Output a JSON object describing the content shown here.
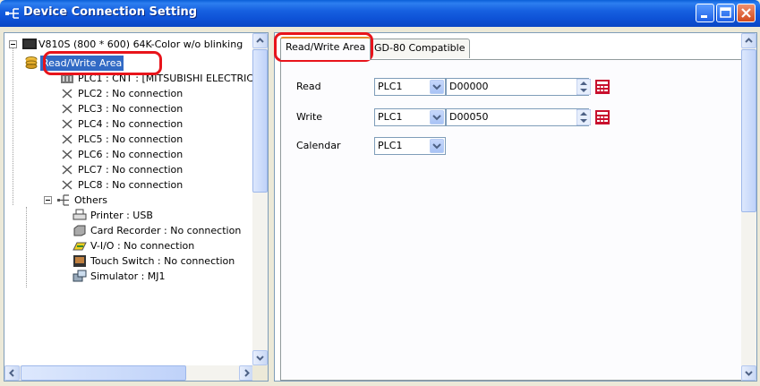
{
  "window": {
    "title": "Device Connection Setting"
  },
  "tree": {
    "root_label": "V810S (800 * 600) 64K-Color w/o blinking",
    "items": [
      {
        "label": "Read/Write Area",
        "icon": "database-icon",
        "selected": true
      },
      {
        "label": "PLC1 : CNT : [MITSUBISHI ELECTRIC",
        "icon": "plc-device-icon"
      },
      {
        "label": "PLC2 : No connection",
        "icon": "x-icon"
      },
      {
        "label": "PLC3 : No connection",
        "icon": "x-icon"
      },
      {
        "label": "PLC4 : No connection",
        "icon": "x-icon"
      },
      {
        "label": "PLC5 : No connection",
        "icon": "x-icon"
      },
      {
        "label": "PLC6 : No connection",
        "icon": "x-icon"
      },
      {
        "label": "PLC7 : No connection",
        "icon": "x-icon"
      },
      {
        "label": "PLC8 : No connection",
        "icon": "x-icon"
      }
    ],
    "others_label": "Others",
    "others_items": [
      {
        "label": "Printer : USB",
        "icon": "printer-icon"
      },
      {
        "label": "Card Recorder : No connection",
        "icon": "card-recorder-icon"
      },
      {
        "label": "V-I/O : No connection",
        "icon": "vio-icon"
      },
      {
        "label": "Touch Switch : No connection",
        "icon": "touch-switch-icon"
      },
      {
        "label": "Simulator : MJ1",
        "icon": "simulator-icon"
      }
    ]
  },
  "tabs": [
    {
      "label": "Read/Write Area",
      "active": true
    },
    {
      "label": "GD-80 Compatible",
      "active": false
    }
  ],
  "form": {
    "read": {
      "label": "Read",
      "plc": "PLC1",
      "address": "D00000"
    },
    "write": {
      "label": "Write",
      "plc": "PLC1",
      "address": "D00050"
    },
    "calendar": {
      "label": "Calendar",
      "plc": "PLC1"
    }
  },
  "colors": {
    "titlebar": "#0a46c4",
    "selection": "#316ac5",
    "highlight_ring": "#e8141b",
    "active_tab_accent": "#e68b2c"
  }
}
